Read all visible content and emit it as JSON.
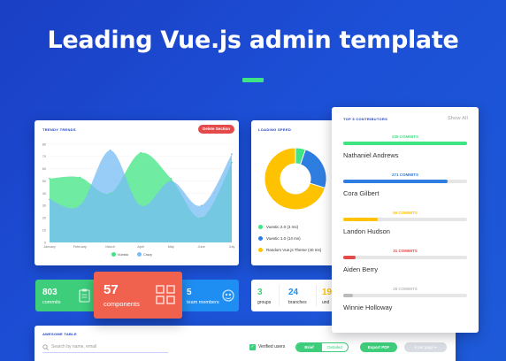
{
  "hero": {
    "title": "Leading Vue.js admin template"
  },
  "trend": {
    "label": "Trendy trends",
    "delete_label": "Delete Section",
    "y_ticks": [
      "80",
      "70",
      "60",
      "50",
      "40",
      "30",
      "20",
      "10",
      "0"
    ],
    "x_ticks": [
      "January",
      "February",
      "March",
      "April",
      "May",
      "June",
      "July"
    ],
    "legend": [
      "Vuestic",
      "Crazy"
    ],
    "colors": {
      "vuestic": "#40e583",
      "crazy": "#76bcf6"
    }
  },
  "chart_data": {
    "type": "area",
    "title": "Trendy trends",
    "categories": [
      "January",
      "February",
      "March",
      "April",
      "May",
      "June",
      "July"
    ],
    "series": [
      {
        "name": "Vuestic",
        "values": [
          52,
          53,
          40,
          73,
          52,
          20,
          65
        ]
      },
      {
        "name": "Crazy",
        "values": [
          35,
          30,
          75,
          30,
          50,
          30,
          72
        ]
      }
    ],
    "ylim": [
      0,
      80
    ],
    "legend": "bottom",
    "grid": true
  },
  "speed": {
    "label": "Loading speed",
    "items": [
      {
        "text": "Vuestic 2.0 (3 ms)",
        "value": 3,
        "color": "#40e583"
      },
      {
        "text": "Vuestic 1.0 (14 ms)",
        "value": 14,
        "color": "#2e7de0"
      },
      {
        "text": "Random Vue.js Theme (40 ms)",
        "value": 40,
        "color": "#ffc200"
      }
    ]
  },
  "stats": {
    "commits": {
      "value": "803",
      "label": "commits"
    },
    "components": {
      "value": "57",
      "label": "components"
    },
    "team": {
      "value": "5",
      "label": "team members"
    },
    "groups": {
      "value": "3",
      "label": "groups"
    },
    "branches": {
      "value": "24",
      "label": "branches"
    },
    "other": {
      "value": "19",
      "label": "und"
    }
  },
  "contributors": {
    "title": "Top 5 contributors",
    "show_all": "Show All",
    "list": [
      {
        "commits": "339 COMMITS",
        "name": "Nathaniel Andrews",
        "fraction": 1.0,
        "color": "#40e583"
      },
      {
        "commits": "271 COMMITS",
        "name": "Cora Gilbert",
        "fraction": 0.84,
        "color": "#2e7de0"
      },
      {
        "commits": "59 COMMITS",
        "name": "Landon Hudson",
        "fraction": 0.28,
        "color": "#ffc200"
      },
      {
        "commits": "31 COMMITS",
        "name": "Aiden Berry",
        "fraction": 0.1,
        "color": "#e34a4a"
      },
      {
        "commits": "28 COMMITS",
        "name": "Winnie Holloway",
        "fraction": 0.08,
        "color": "#bbbbbb"
      }
    ]
  },
  "table": {
    "label": "Awesome table",
    "search_placeholder": "Search by name, email",
    "verified_label": "Verified users",
    "brief_label": "Brief",
    "detailed_label": "Detailed",
    "export_label": "Export PDF",
    "perpage_label": "6 per page"
  }
}
